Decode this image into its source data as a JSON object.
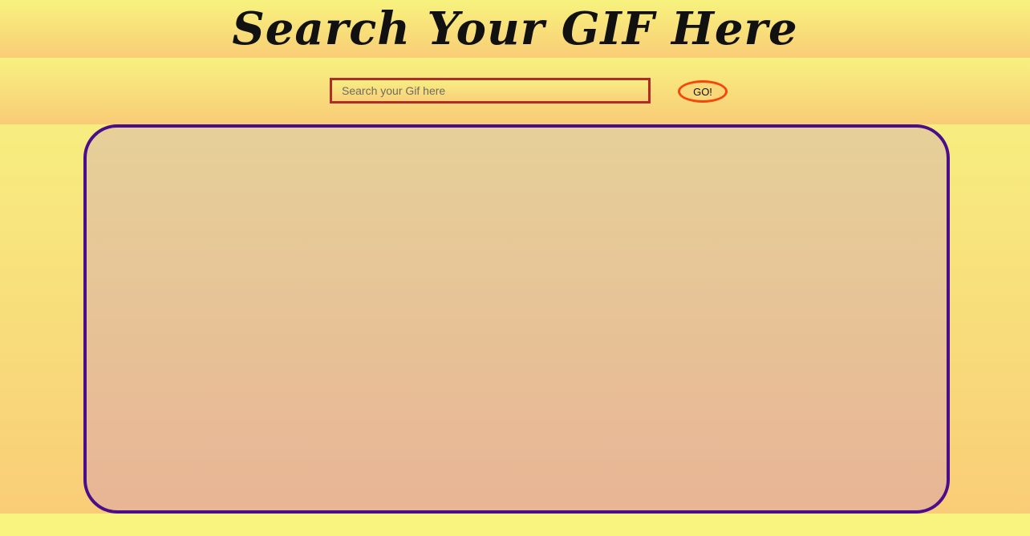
{
  "header": {
    "title": "Search Your GIF Here"
  },
  "search": {
    "placeholder": "Search your Gif here",
    "value": "",
    "button_label": "GO!"
  },
  "results": {
    "items": []
  },
  "colors": {
    "background": "#f8f47f",
    "input_border": "#b12c26",
    "button_border": "#f4470c",
    "panel_border": "#4b0e8a"
  }
}
